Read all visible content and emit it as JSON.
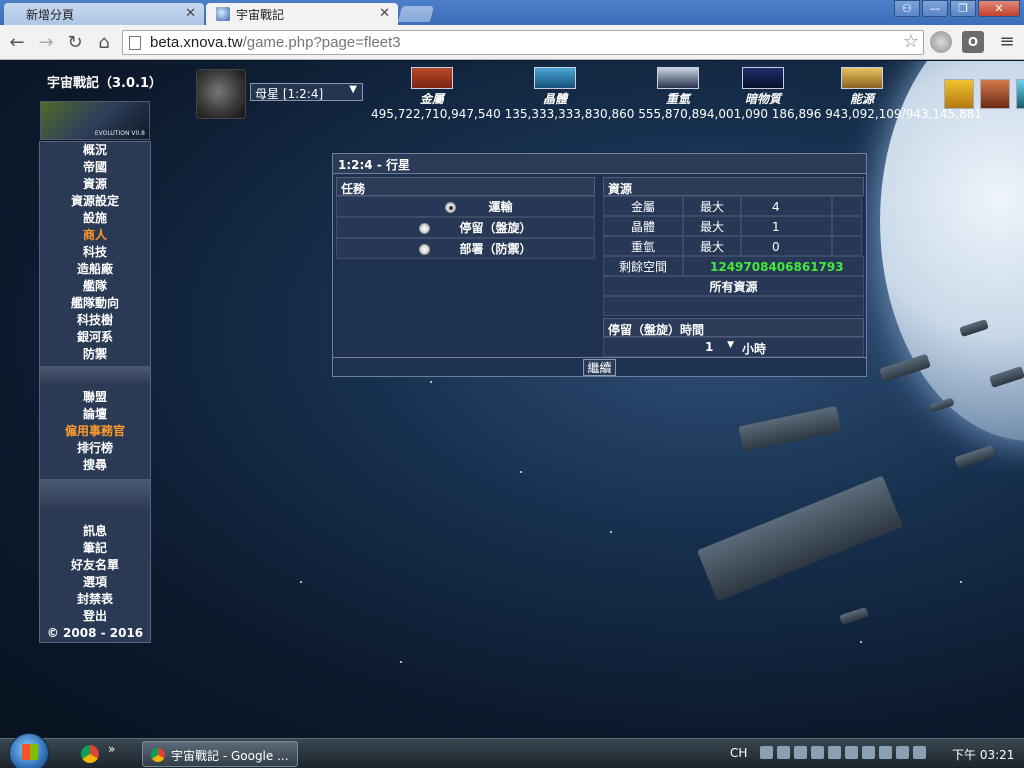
{
  "browser": {
    "tabs": [
      {
        "label": "新增分頁"
      },
      {
        "label": "宇宙戰記"
      }
    ],
    "url": {
      "host": "beta.xnova.tw",
      "path": "/game.php?page=fleet3"
    }
  },
  "game": {
    "title": "宇宙戰記（3.0.1）",
    "logo_caption": "EVOLUTION V0.8",
    "menu_main": [
      {
        "label": "概況"
      },
      {
        "label": "帝國"
      },
      {
        "label": "資源"
      },
      {
        "label": "資源設定"
      },
      {
        "label": "設施"
      },
      {
        "label": "商人",
        "highlight": true
      },
      {
        "label": "科技"
      },
      {
        "label": "造船廠"
      },
      {
        "label": "艦隊"
      },
      {
        "label": "艦隊動向"
      },
      {
        "label": "科技樹"
      },
      {
        "label": "銀河系"
      },
      {
        "label": "防禦"
      }
    ],
    "menu_social": [
      {
        "label": "聯盟"
      },
      {
        "label": "論壇"
      },
      {
        "label": "僱用事務官",
        "highlight": true
      },
      {
        "label": "排行榜"
      },
      {
        "label": "搜尋"
      }
    ],
    "menu_user": [
      {
        "label": "訊息"
      },
      {
        "label": "筆記"
      },
      {
        "label": "好友名單"
      },
      {
        "label": "選項"
      },
      {
        "label": "封禁表"
      },
      {
        "label": "登出"
      },
      {
        "label": "© 2008 - 2016"
      }
    ],
    "planet_select": "母星 [1:2:4]",
    "resources": {
      "labels": [
        "金屬",
        "晶體",
        "重氫",
        "暗物質",
        "能源"
      ],
      "values": "495,722,710,947,540 135,333,333,830,860 555,870,894,001,090 186,896 943,092,109/943,145,881"
    },
    "fleet": {
      "title": "1:2:4 - 行星",
      "mission_header": "任務",
      "missions": [
        {
          "label": "運輸",
          "selected": true
        },
        {
          "label": "停留（盤旋）",
          "selected": false
        },
        {
          "label": "部署（防禦）",
          "selected": false
        }
      ],
      "resources_header": "資源",
      "resource_rows": [
        {
          "name": "金屬",
          "max": "最大",
          "value": "4"
        },
        {
          "name": "晶體",
          "max": "最大",
          "value": "1"
        },
        {
          "name": "重氫",
          "max": "最大",
          "value": "0"
        }
      ],
      "space_label": "剩餘空間",
      "space_value": "1249708406861793",
      "all_resources": "所有資源",
      "hold_header": "停留（盤旋）時間",
      "hold_value": "1",
      "hold_unit": "小時",
      "continue": "繼續"
    }
  },
  "taskbar": {
    "window_label": "宇宙戰記 - Google ...",
    "lang": "CH",
    "clock": "下午 03:21"
  }
}
